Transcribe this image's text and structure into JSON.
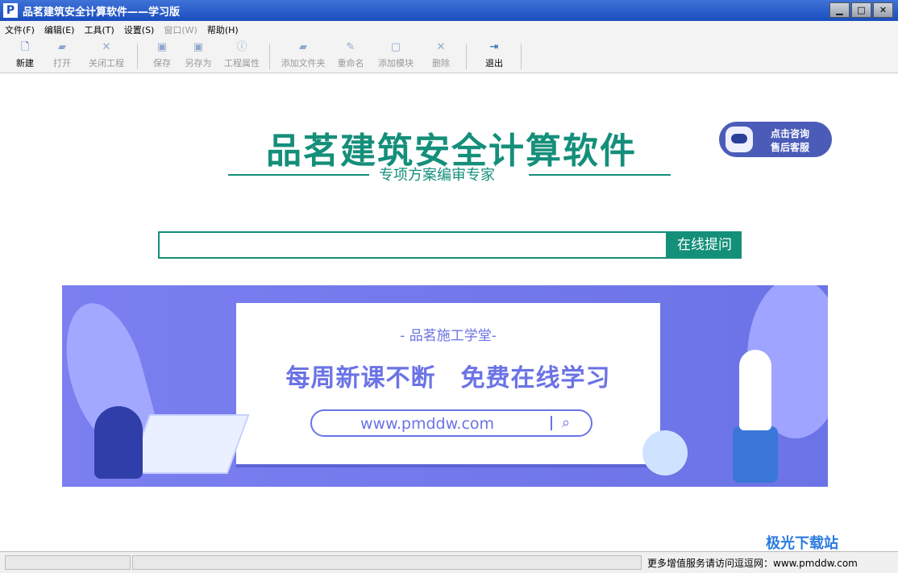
{
  "window": {
    "title": "品茗建筑安全计算软件——学习版",
    "icon_letter": "P"
  },
  "window_buttons": [
    "minimize-icon",
    "maximize-icon",
    "close-icon"
  ],
  "menu": [
    {
      "label": "文件(F)",
      "enabled": true
    },
    {
      "label": "编辑(E)",
      "enabled": true
    },
    {
      "label": "工具(T)",
      "enabled": true
    },
    {
      "label": "设置(S)",
      "enabled": true
    },
    {
      "label": "窗口(W)",
      "enabled": false
    },
    {
      "label": "帮助(H)",
      "enabled": true
    }
  ],
  "toolbar": {
    "new": {
      "label": "新建",
      "icon": "new-file-icon",
      "enabled": true
    },
    "open": {
      "label": "打开",
      "icon": "open-folder-icon",
      "enabled": false
    },
    "close_project": {
      "label": "关闭工程",
      "icon": "close-x-icon",
      "enabled": false
    },
    "save": {
      "label": "保存",
      "icon": "save-icon",
      "enabled": false
    },
    "save_as": {
      "label": "另存为",
      "icon": "save-as-icon",
      "enabled": false
    },
    "properties": {
      "label": "工程属性",
      "icon": "info-icon",
      "enabled": false
    },
    "add_folder": {
      "label": "添加文件夹",
      "icon": "add-folder-icon",
      "enabled": false
    },
    "rename": {
      "label": "重命名",
      "icon": "rename-icon",
      "enabled": false
    },
    "add_module": {
      "label": "添加模块",
      "icon": "add-module-icon",
      "enabled": false
    },
    "delete": {
      "label": "删除",
      "icon": "delete-x-icon",
      "enabled": false
    },
    "exit": {
      "label": "退出",
      "icon": "exit-icon",
      "enabled": true
    }
  },
  "brand": {
    "title": "品茗建筑安全计算软件",
    "subtitle": "专项方案编审专家",
    "color": "#148f7a"
  },
  "consult": {
    "line1": "点击咨询",
    "line2": "售后客服",
    "icon": "robot-icon"
  },
  "search": {
    "value": "",
    "placeholder": "",
    "button_label": "在线提问"
  },
  "banner": {
    "kicker": "- 品茗施工学堂-",
    "headline": "每周新课不断　免费在线学习",
    "url": "www.pmddw.com",
    "icon": "search-icon",
    "color": "#6b73e6"
  },
  "status": {
    "text": "更多增值服务请访问逗逗网：www.pmddw.com"
  },
  "watermark": {
    "text": "极光下载站"
  }
}
